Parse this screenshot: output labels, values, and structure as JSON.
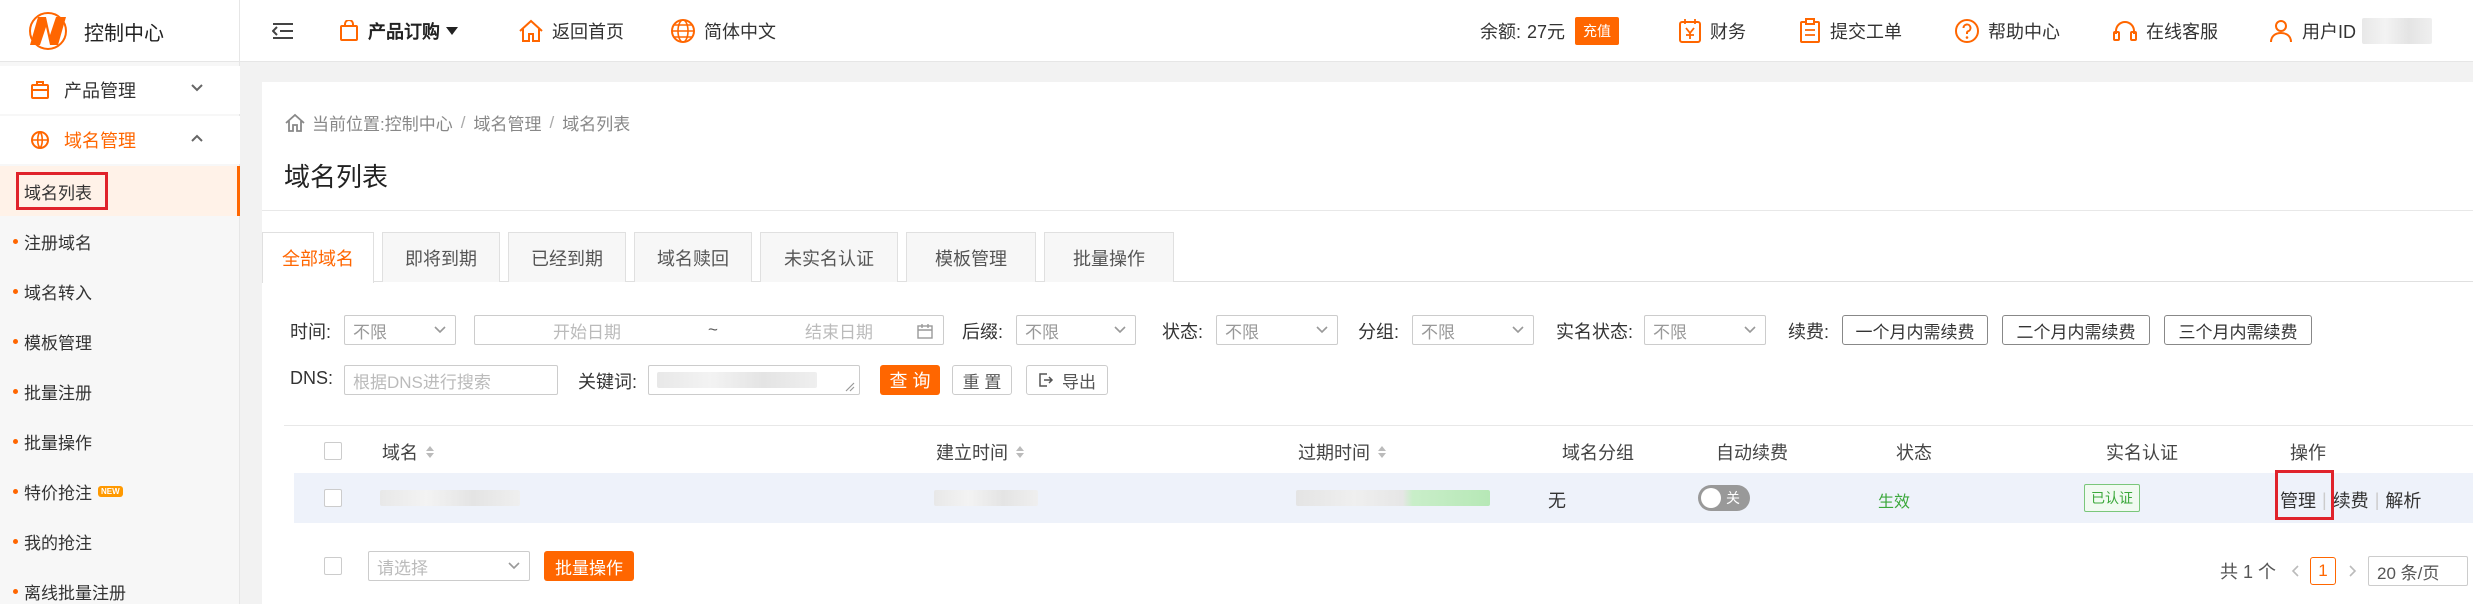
{
  "topbar": {
    "logo_text": "控制中心",
    "product_order": "产品订购",
    "back_home": "返回首页",
    "language": "简体中文",
    "balance_label": "余额:",
    "balance_value": "27元",
    "recharge": "充值",
    "finance": "财务",
    "submit_ticket": "提交工单",
    "help_center": "帮助中心",
    "online_service": "在线客服",
    "user_id_label": "用户ID"
  },
  "sidebar": {
    "product_mgmt": "产品管理",
    "domain_mgmt": "域名管理",
    "items": [
      {
        "label": "域名列表"
      },
      {
        "label": "注册域名"
      },
      {
        "label": "域名转入"
      },
      {
        "label": "模板管理"
      },
      {
        "label": "批量注册"
      },
      {
        "label": "批量操作"
      },
      {
        "label": "特价抢注",
        "badge": "NEW"
      },
      {
        "label": "我的抢注"
      },
      {
        "label": "离线批量注册"
      }
    ]
  },
  "breadcrumb": {
    "prefix": "当前位置:",
    "items": [
      "控制中心",
      "域名管理",
      "域名列表"
    ]
  },
  "page_title": "域名列表",
  "tabs": [
    "全部域名",
    "即将到期",
    "已经到期",
    "域名赎回",
    "未实名认证",
    "模板管理",
    "批量操作"
  ],
  "filters": {
    "time_label": "时间:",
    "time_value": "不限",
    "start_date": "开始日期",
    "date_sep": "~",
    "end_date": "结束日期",
    "suffix_label": "后缀:",
    "suffix_value": "不限",
    "status_label": "状态:",
    "status_value": "不限",
    "group_label": "分组:",
    "group_value": "不限",
    "realname_label": "实名状态:",
    "realname_value": "不限",
    "renew_label": "续费:",
    "renew_1": "一个月内需续费",
    "renew_2": "二个月内需续费",
    "renew_3": "三个月内需续费",
    "dns_label": "DNS:",
    "dns_placeholder": "根据DNS进行搜索",
    "keyword_label": "关键词:",
    "query": "查 询",
    "reset": "重 置",
    "export": "导出"
  },
  "table": {
    "headers": {
      "domain": "域名",
      "created": "建立时间",
      "expires": "过期时间",
      "group": "域名分组",
      "auto_renew": "自动续费",
      "status": "状态",
      "realname": "实名认证",
      "actions": "操作"
    },
    "rows": [
      {
        "group": "无",
        "auto_renew": "关",
        "status": "生效",
        "realname": "已认证",
        "action_manage": "管理",
        "action_renew": "续费",
        "action_resolve": "解析"
      }
    ]
  },
  "footer": {
    "select_placeholder": "请选择",
    "batch_action": "批量操作",
    "total": "共 1 个",
    "current_page": "1",
    "page_size": "20 条/页"
  },
  "colors": {
    "accent": "#ff6600",
    "highlight_box": "#e0232b",
    "success": "#3ba83b"
  }
}
